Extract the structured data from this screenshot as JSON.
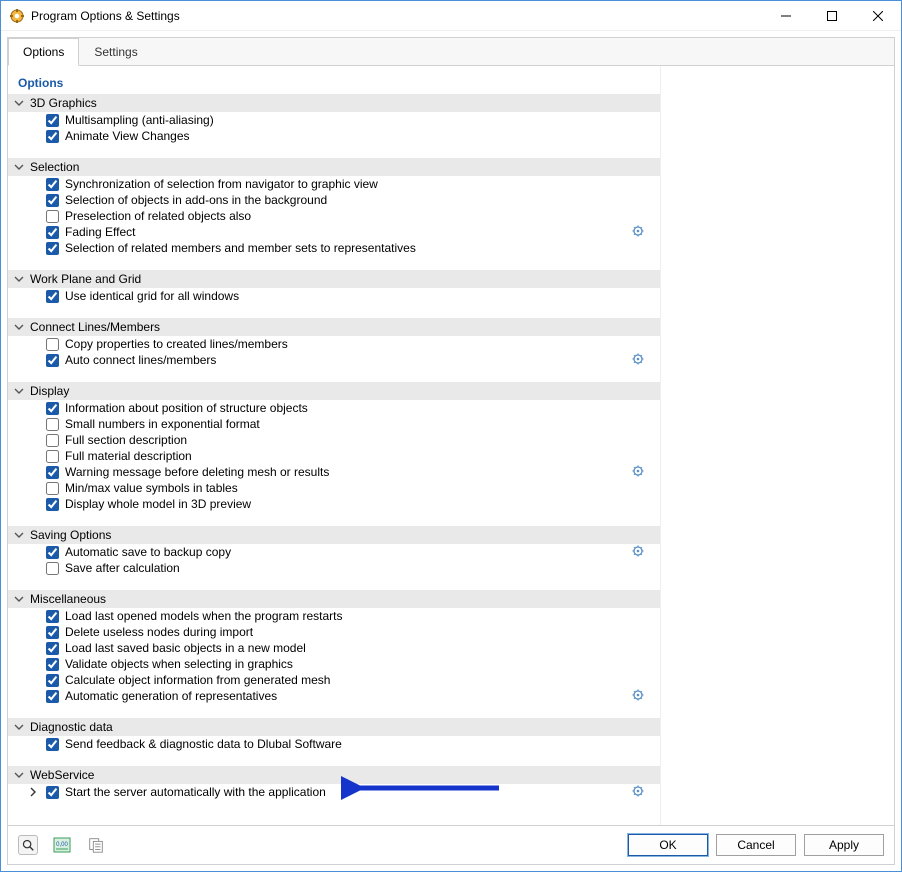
{
  "window": {
    "title": "Program Options & Settings",
    "buttons": {
      "minimize": "Minimize",
      "maximize": "Maximize",
      "close": "Close"
    }
  },
  "tabs": [
    {
      "label": "Options",
      "active": true
    },
    {
      "label": "Settings",
      "active": false
    }
  ],
  "panel_title": "Options",
  "sections": [
    {
      "title": "3D Graphics",
      "items": [
        {
          "label": "Multisampling (anti-aliasing)",
          "checked": true
        },
        {
          "label": "Animate View Changes",
          "checked": true
        }
      ]
    },
    {
      "title": "Selection",
      "items": [
        {
          "label": "Synchronization of selection from navigator to graphic view",
          "checked": true
        },
        {
          "label": "Selection of objects in add-ons in the background",
          "checked": true
        },
        {
          "label": "Preselection of related objects also",
          "checked": false
        },
        {
          "label": "Fading Effect",
          "checked": true,
          "gear": true
        },
        {
          "label": "Selection of related members and member sets to representatives",
          "checked": true
        }
      ]
    },
    {
      "title": "Work Plane and Grid",
      "items": [
        {
          "label": "Use identical grid for all windows",
          "checked": true
        }
      ]
    },
    {
      "title": "Connect Lines/Members",
      "items": [
        {
          "label": "Copy properties to created lines/members",
          "checked": false
        },
        {
          "label": "Auto connect lines/members",
          "checked": true,
          "gear": true
        }
      ]
    },
    {
      "title": "Display",
      "items": [
        {
          "label": "Information about position of structure objects",
          "checked": true
        },
        {
          "label": "Small numbers in exponential format",
          "checked": false
        },
        {
          "label": "Full section description",
          "checked": false
        },
        {
          "label": "Full material description",
          "checked": false
        },
        {
          "label": "Warning message before deleting mesh or results",
          "checked": true,
          "gear": true
        },
        {
          "label": "Min/max value symbols in tables",
          "checked": false
        },
        {
          "label": "Display whole model in 3D preview",
          "checked": true
        }
      ]
    },
    {
      "title": "Saving Options",
      "items": [
        {
          "label": "Automatic save to backup copy",
          "checked": true,
          "gear": true
        },
        {
          "label": "Save after calculation",
          "checked": false
        }
      ]
    },
    {
      "title": "Miscellaneous",
      "items": [
        {
          "label": "Load last opened models when the program restarts",
          "checked": true
        },
        {
          "label": "Delete useless nodes during import",
          "checked": true
        },
        {
          "label": "Load last saved basic objects in a new model",
          "checked": true
        },
        {
          "label": "Validate objects when selecting in graphics",
          "checked": true
        },
        {
          "label": "Calculate object information from generated mesh",
          "checked": true
        },
        {
          "label": "Automatic generation of representatives",
          "checked": true,
          "gear": true
        }
      ]
    },
    {
      "title": "Diagnostic data",
      "items": [
        {
          "label": "Send feedback & diagnostic data to Dlubal Software",
          "checked": true
        }
      ]
    },
    {
      "title": "WebService",
      "items": [
        {
          "label": "Start the server automatically with the application",
          "checked": true,
          "gear": true,
          "row_chev": true
        }
      ]
    }
  ],
  "buttons": {
    "ok": "OK",
    "cancel": "Cancel",
    "apply": "Apply"
  },
  "status_icons": {
    "help": "help-icon",
    "units": "units-icon",
    "copy": "copy-icon"
  }
}
